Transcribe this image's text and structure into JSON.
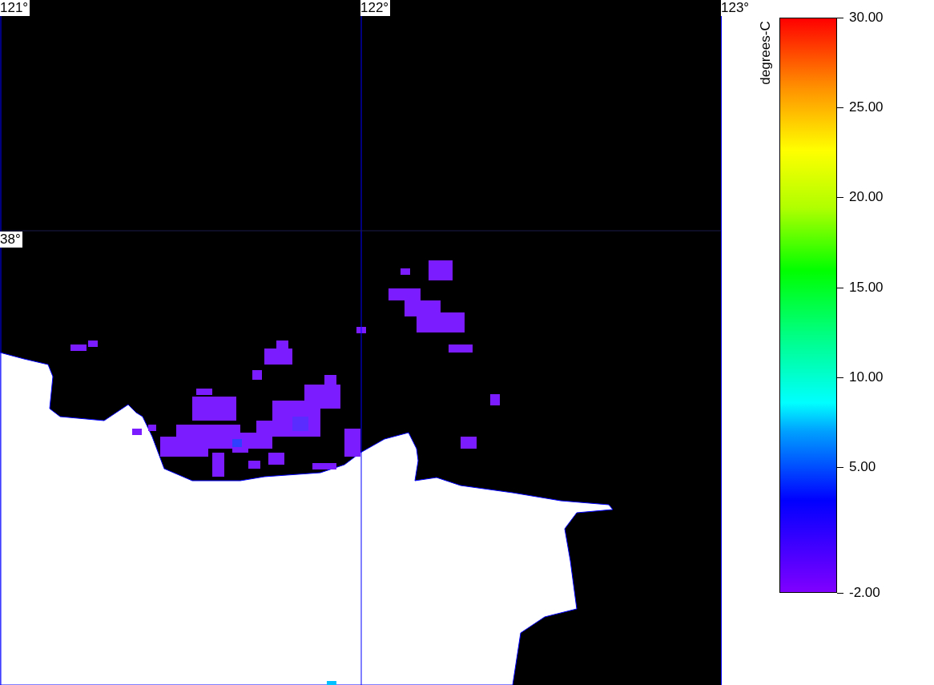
{
  "map": {
    "grid_labels": [
      {
        "kind": "longitude",
        "text": "121°"
      },
      {
        "kind": "longitude",
        "text": "122°"
      },
      {
        "kind": "longitude",
        "text": "123°"
      },
      {
        "kind": "latitude",
        "text": "38°"
      }
    ]
  },
  "colorbar": {
    "unit": "degrees-C",
    "ticks": [
      "30.00",
      "25.00",
      "20.00",
      "15.00",
      "10.00",
      "5.00",
      "-2.00"
    ]
  }
}
